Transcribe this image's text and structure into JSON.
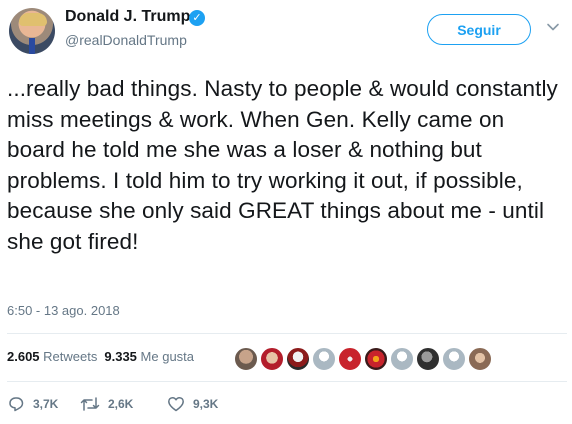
{
  "user": {
    "name": "Donald J. Trump",
    "handle": "@realDonaldTrump",
    "verified_mark": "✓"
  },
  "follow_label": "Seguir",
  "tweet_text": "...really bad things. Nasty to people & would constantly miss meetings & work. When Gen. Kelly came on board he told me she was a loser & nothing but problems. I told him to try working it out, if possible, because she only said GREAT things about me - until she got fired!",
  "timestamp": "6:50 - 13 ago. 2018",
  "stats": {
    "retweets_count": "2.605",
    "retweets_label": "Retweets",
    "likes_count": "9.335",
    "likes_label": "Me gusta"
  },
  "liker_avatars": 10,
  "actions": {
    "replies": "3,7K",
    "retweets": "2,6K",
    "likes": "9,3K"
  },
  "colors": {
    "accent": "#1da1f2",
    "muted": "#657786",
    "text": "#14171a",
    "divider": "#e6ecf0"
  },
  "icons": [
    "verified-badge-icon",
    "caret-down-icon",
    "reply-icon",
    "retweet-icon",
    "like-icon"
  ]
}
